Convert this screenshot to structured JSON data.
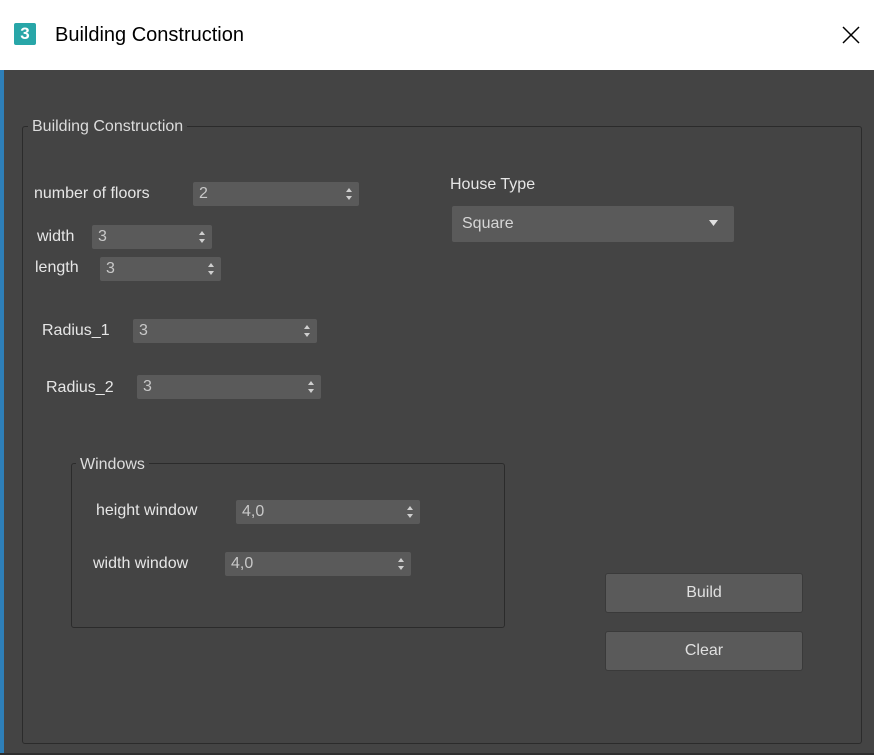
{
  "window": {
    "icon_text": "3",
    "title": "Building Construction"
  },
  "main_group": {
    "legend": "Building Construction",
    "floors": {
      "label": "number of floors",
      "value": "2"
    },
    "width": {
      "label": "width",
      "value": "3"
    },
    "length": {
      "label": "length",
      "value": "3"
    },
    "radius1": {
      "label": "Radius_1",
      "value": "3"
    },
    "radius2": {
      "label": "Radius_2",
      "value": "3"
    },
    "house_type": {
      "label": "House Type",
      "selected": "Square"
    }
  },
  "windows_group": {
    "legend": "Windows",
    "height_window": {
      "label": "height window",
      "value": "4,0"
    },
    "width_window": {
      "label": "width window",
      "value": "4,0"
    }
  },
  "buttons": {
    "build": "Build",
    "clear": "Clear"
  },
  "colors": {
    "background": "#444444",
    "field": "#5a5a5a",
    "accent_edge": "#2e7fb8",
    "app_icon": "#28a6a8"
  },
  "icons": [
    "app-icon",
    "close-icon",
    "spin-arrows-icon",
    "dropdown-arrow-icon"
  ]
}
